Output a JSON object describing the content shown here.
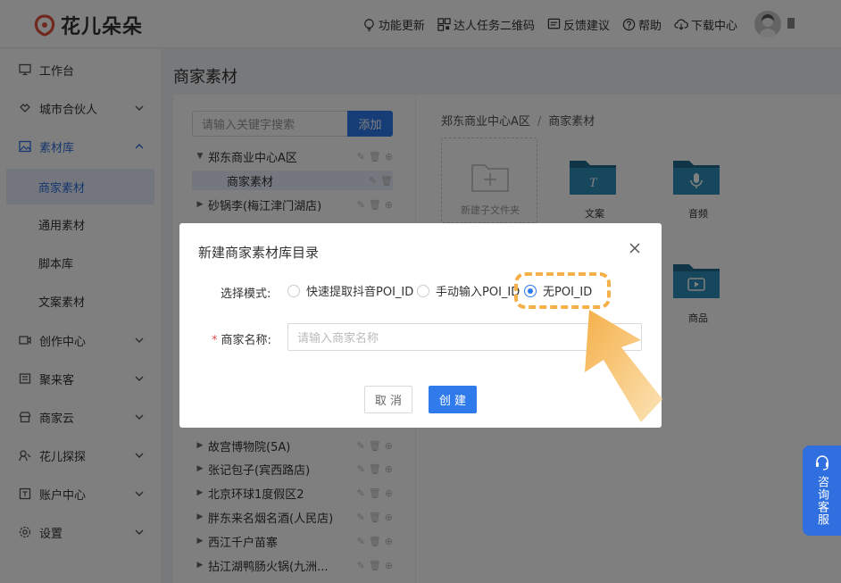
{
  "header": {
    "logo_text": "花儿朵朵",
    "nav": [
      {
        "label": "功能更新",
        "icon": "bulb-icon"
      },
      {
        "label": "达人任务二维码",
        "icon": "qrcode-icon"
      },
      {
        "label": "反馈建议",
        "icon": "feedback-icon"
      },
      {
        "label": "帮助",
        "icon": "help-icon"
      },
      {
        "label": "下载中心",
        "icon": "cloud-download-icon"
      }
    ]
  },
  "sidebar": {
    "items": [
      {
        "label": "工作台",
        "icon": "monitor-icon"
      },
      {
        "label": "城市合伙人",
        "icon": "partner-icon"
      },
      {
        "label": "素材库",
        "icon": "image-icon"
      },
      {
        "label": "商家素材"
      },
      {
        "label": "通用素材"
      },
      {
        "label": "脚本库"
      },
      {
        "label": "文案素材"
      },
      {
        "label": "创作中心",
        "icon": "video-icon"
      },
      {
        "label": "聚来客",
        "icon": "store-icon"
      },
      {
        "label": "商家云",
        "icon": "shop-icon"
      },
      {
        "label": "花儿探探",
        "icon": "explore-icon"
      },
      {
        "label": "账户中心",
        "icon": "account-icon"
      },
      {
        "label": "设置",
        "icon": "settings-icon"
      }
    ]
  },
  "page": {
    "title": "商家素材"
  },
  "left_panel": {
    "search_placeholder": "请输入关键字搜索",
    "add_label": "添加",
    "tree": [
      {
        "label": "郑东商业中心A区",
        "expanded": true
      },
      {
        "label": "商家素材",
        "child": true
      },
      {
        "label": "砂锅李(梅江津门湖店)"
      },
      {
        "label": "故宫博物院(5A)"
      },
      {
        "label": "张记包子(宾西路店)"
      },
      {
        "label": "北京环球1度假区2"
      },
      {
        "label": "胖东来名烟名酒(人民店)"
      },
      {
        "label": "西江千户苗寨"
      },
      {
        "label": "拈江湖鸭肠火锅(九洲..."
      }
    ]
  },
  "right_panel": {
    "breadcrumb": [
      "郑东商业中心A区",
      "商家素材"
    ],
    "new_folder_label": "新建子文件夹",
    "folders": [
      {
        "label": "文案",
        "icon": "text-folder-icon"
      },
      {
        "label": "音频",
        "icon": "audio-folder-icon"
      },
      {
        "label": "商品",
        "icon": "video-folder-icon"
      }
    ]
  },
  "modal": {
    "title": "新建商家素材库目录",
    "mode_label": "选择模式:",
    "options": [
      {
        "label": "快速提取抖音POI_ID",
        "checked": false
      },
      {
        "label": "手动输入POI_ID",
        "checked": false
      },
      {
        "label": "无POI_ID",
        "checked": true
      }
    ],
    "name_required_mark": "*",
    "name_label": "商家名称:",
    "name_placeholder": "请输入商家名称",
    "cancel_label": "取 消",
    "create_label": "创 建"
  },
  "service": {
    "label": "咨询客服"
  },
  "colors": {
    "primary": "#2f7bec",
    "highlight": "#f5b04a",
    "logo": "#e2533f"
  }
}
